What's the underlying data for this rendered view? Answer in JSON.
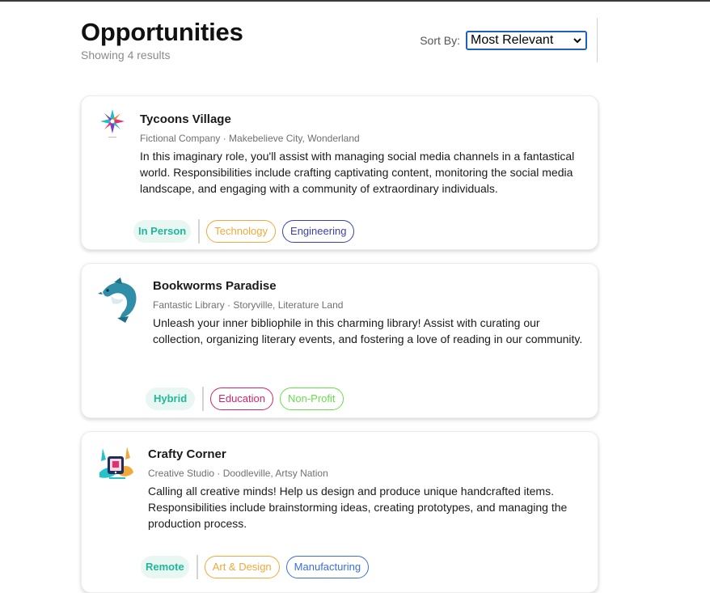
{
  "header": {
    "title": "Opportunities",
    "subtitle": "Showing 4 results",
    "sort_label": "Sort By:",
    "sort_value": "Most Relevant"
  },
  "opportunities": [
    {
      "title": "Tycoons Village",
      "meta": "Fictional Company · Makebelieve City, Wonderland",
      "description": "In this imaginary role, you'll assist with managing social media channels in a fantastical world. Responsibilities include crafting captivating content, monitoring the social media landscape, and engaging with a community of extraordinary individuals.",
      "work_type": "In Person",
      "tags": [
        {
          "label": "Technology",
          "color": "#f0a93a"
        },
        {
          "label": "Engineering",
          "color": "#3b3fb0"
        }
      ],
      "logo_icon": "flower-logo-icon"
    },
    {
      "title": "Bookworms Paradise",
      "meta": "Fantastic Library · Storyville, Literature Land",
      "description": "Unleash your inner bibliophile in this charming library! Assist with curating our collection, organizing literary events, and fostering a love of reading in our community.",
      "work_type": "Hybrid",
      "tags": [
        {
          "label": "Education",
          "color": "#d6246a"
        },
        {
          "label": "Non-Profit",
          "color": "#66e04a"
        }
      ],
      "logo_icon": "dolphin-logo-icon"
    },
    {
      "title": "Crafty Corner",
      "meta": "Creative Studio · Doodleville, Artsy Nation",
      "description": "Calling all creative minds! Help us design and produce unique handcrafted items. Responsibilities include brainstorming ideas, creating prototypes, and managing the production process.",
      "work_type": "Remote",
      "tags": [
        {
          "label": "Art & Design",
          "color": "#f0a93a"
        },
        {
          "label": "Manufacturing",
          "color": "#3a6fd8"
        }
      ],
      "logo_icon": "craft-logo-icon"
    }
  ],
  "colors": {
    "work_type_text": "#1fb89a",
    "work_type_bg": "#e9f7f3",
    "select_border": "#1f5fbf"
  }
}
